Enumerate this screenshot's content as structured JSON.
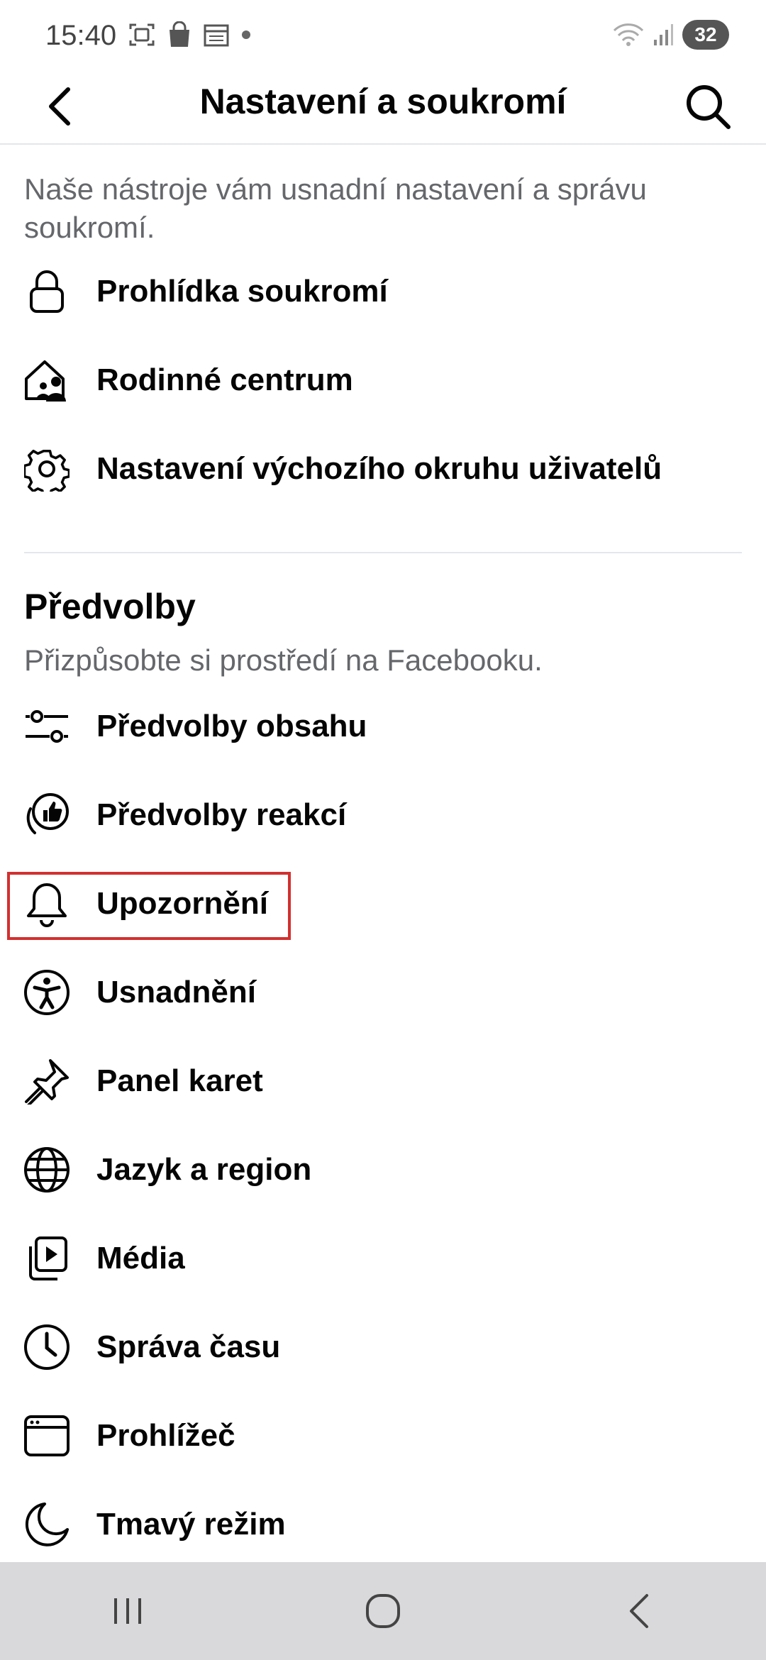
{
  "status_bar": {
    "time": "15:40",
    "battery": "32",
    "left_icons": [
      "screenshot-icon",
      "shopping-bag-icon",
      "calendar-icon",
      "dot-icon"
    ],
    "right_icons": [
      "wifi-icon",
      "signal-icon"
    ]
  },
  "header": {
    "title": "Nastavení a soukromí",
    "back_icon": "chevron-left-icon",
    "search_icon": "search-icon"
  },
  "privacy_section": {
    "description": "Naše nástroje vám usnadní nastavení a správu soukromí.",
    "items": [
      {
        "label": "Prohlídka soukromí",
        "icon": "lock-icon"
      },
      {
        "label": "Rodinné centrum",
        "icon": "family-center-icon"
      },
      {
        "label": "Nastavení výchozího okruhu uživatelů",
        "icon": "gear-icon"
      }
    ]
  },
  "preferences_section": {
    "title": "Předvolby",
    "description": "Přizpůsobte si prostředí na Facebooku.",
    "items": [
      {
        "label": "Předvolby obsahu",
        "icon": "sliders-icon"
      },
      {
        "label": "Předvolby reakcí",
        "icon": "reactions-icon"
      },
      {
        "label": "Upozornění",
        "icon": "bell-icon",
        "highlighted": true
      },
      {
        "label": "Usnadnění",
        "icon": "accessibility-icon"
      },
      {
        "label": "Panel karet",
        "icon": "pin-icon"
      },
      {
        "label": "Jazyk a region",
        "icon": "globe-icon"
      },
      {
        "label": "Média",
        "icon": "media-icon"
      },
      {
        "label": "Správa času",
        "icon": "clock-icon"
      },
      {
        "label": "Prohlížeč",
        "icon": "browser-icon"
      },
      {
        "label": "Tmavý režim",
        "icon": "moon-icon"
      }
    ]
  },
  "nav_bar": {
    "buttons": [
      "recent-apps-icon",
      "home-icon",
      "back-icon"
    ]
  },
  "colors": {
    "highlight": "#d32f2f",
    "secondary_text": "#65676b",
    "nav_background": "#d9d9dc"
  }
}
